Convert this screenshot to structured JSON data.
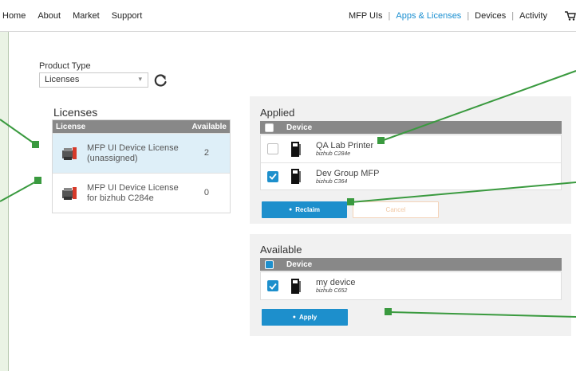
{
  "nav": {
    "left": [
      "Home",
      "About",
      "Market",
      "Support"
    ],
    "right": [
      "MFP UIs",
      "Apps & Licenses",
      "Devices",
      "Activity"
    ],
    "active_index": 1,
    "separator": "|",
    "cart_icon": "cart-icon"
  },
  "product_type": {
    "label": "Product Type",
    "selected": "Licenses",
    "refresh_icon": "refresh-icon"
  },
  "licenses": {
    "title": "Licenses",
    "col_license": "License",
    "col_available": "Available",
    "rows": [
      {
        "name": "MFP UI Device License (unassigned)",
        "available": "2"
      },
      {
        "name": "MFP UI Device License for bizhub C284e",
        "available": "0"
      }
    ]
  },
  "applied": {
    "title": "Applied",
    "col_device": "Device",
    "devices": [
      {
        "name": "QA Lab Printer",
        "model": "bizhub C284e",
        "checked": false
      },
      {
        "name": "Dev Group MFP",
        "model": "bizhub C364",
        "checked": true
      }
    ],
    "reclaim_label": "Reclaim",
    "cancel_label": "Cancel"
  },
  "available": {
    "title": "Available",
    "col_device": "Device",
    "devices": [
      {
        "name": "my device",
        "model": "bizhub C652",
        "checked": true
      }
    ],
    "apply_label": "Apply"
  },
  "colors": {
    "accent": "#1d8fcc",
    "callout": "#3a9a3f",
    "header_grey": "#888888"
  }
}
